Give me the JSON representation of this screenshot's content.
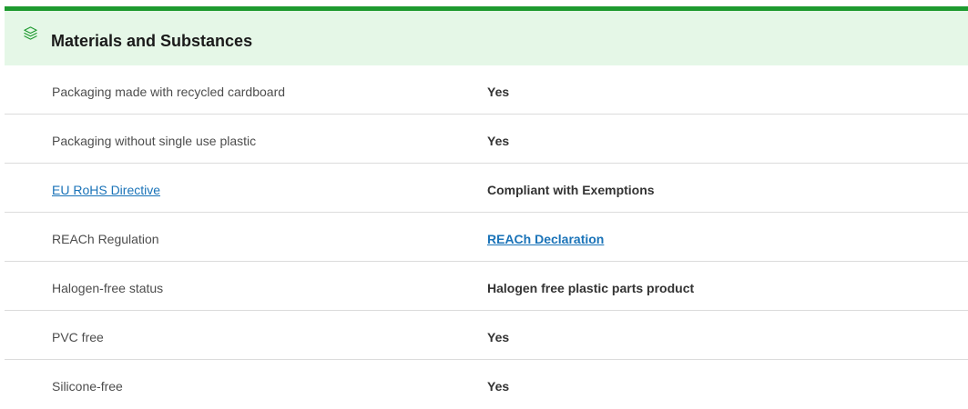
{
  "section": {
    "title": "Materials and Substances",
    "icon": "layers-icon",
    "accent_color": "#1e9a2f",
    "header_bg": "#e5f7e7",
    "link_color": "#1a73b8"
  },
  "rows": [
    {
      "label": "Packaging made with recycled cardboard",
      "value": "Yes",
      "label_is_link": false,
      "value_is_link": false
    },
    {
      "label": "Packaging without single use plastic",
      "value": "Yes",
      "label_is_link": false,
      "value_is_link": false
    },
    {
      "label": "EU RoHS Directive",
      "value": "Compliant with Exemptions",
      "label_is_link": true,
      "value_is_link": false
    },
    {
      "label": "REACh Regulation",
      "value": "REACh Declaration",
      "label_is_link": false,
      "value_is_link": true
    },
    {
      "label": "Halogen-free status",
      "value": "Halogen free plastic parts product",
      "label_is_link": false,
      "value_is_link": false
    },
    {
      "label": "PVC free",
      "value": "Yes",
      "label_is_link": false,
      "value_is_link": false
    },
    {
      "label": "Silicone-free",
      "value": "Yes",
      "label_is_link": false,
      "value_is_link": false
    }
  ]
}
